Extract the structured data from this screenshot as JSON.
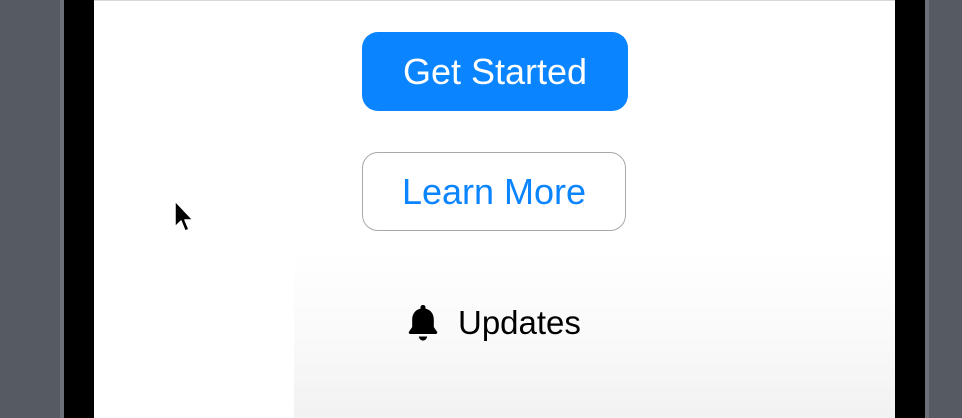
{
  "screen": {
    "primary_button": {
      "label": "Get Started",
      "color": "#0a84ff"
    },
    "secondary_button": {
      "label": "Learn More",
      "color": "#0a84ff"
    },
    "updates": {
      "icon": "bell-icon",
      "label": "Updates"
    }
  },
  "colors": {
    "background": "#555a63",
    "frame": "#000000",
    "screen": "#ffffff"
  }
}
